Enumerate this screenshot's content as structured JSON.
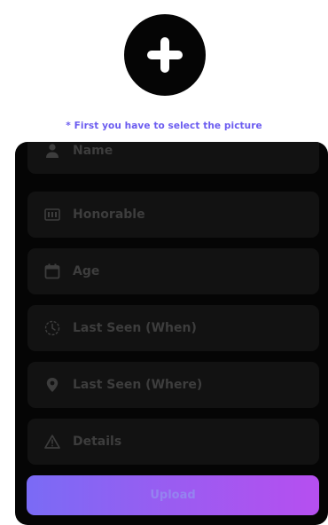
{
  "hint": "* First you have to select the picture",
  "fields": [
    {
      "icon": "person-icon",
      "placeholder": "Name"
    },
    {
      "icon": "badge-icon",
      "placeholder": "Honorable"
    },
    {
      "icon": "calendar-icon",
      "placeholder": "Age"
    },
    {
      "icon": "clock-icon",
      "placeholder": "Last Seen (When)"
    },
    {
      "icon": "location-pin-icon",
      "placeholder": "Last Seen (Where)"
    },
    {
      "icon": "warning-icon",
      "placeholder": "Details"
    }
  ],
  "upload_label": "Upload",
  "colors": {
    "accent_start": "#7a6bf5",
    "accent_end": "#b64ff0",
    "hint": "#6b5cf0",
    "panel": "#050505",
    "field": "#121212",
    "field_text": "#3d3d3d"
  }
}
